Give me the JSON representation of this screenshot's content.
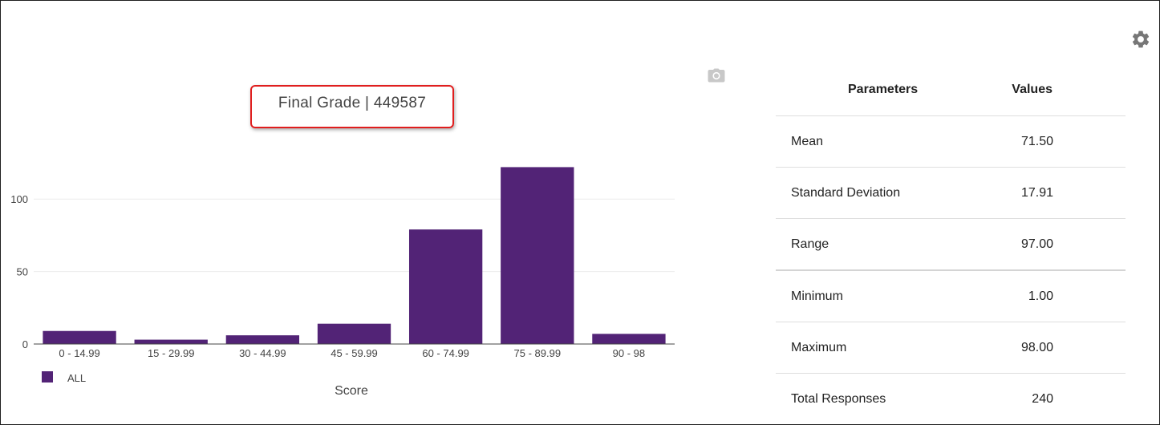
{
  "chart_data": {
    "type": "bar",
    "title": "Final Grade | 449587",
    "categories": [
      "0 - 14.99",
      "15 - 29.99",
      "30 - 44.99",
      "45 - 59.99",
      "60 - 74.99",
      "75 - 89.99",
      "90 - 98"
    ],
    "series": [
      {
        "name": "ALL",
        "values": [
          9,
          3,
          6,
          14,
          79,
          122,
          7
        ]
      }
    ],
    "xlabel": "Score",
    "ylabel": "",
    "ylim": [
      0,
      125
    ],
    "yticks": [
      0,
      50,
      100
    ],
    "grid": true,
    "legend": "bottom-left",
    "bar_color": "#522376"
  },
  "stats": {
    "header": {
      "param": "Parameters",
      "value": "Values"
    },
    "rows": [
      {
        "param": "Mean",
        "value": "71.50"
      },
      {
        "param": "Standard Deviation",
        "value": "17.91"
      },
      {
        "param": "Range",
        "value": "97.00"
      },
      {
        "param": "Minimum",
        "value": "1.00"
      },
      {
        "param": "Maximum",
        "value": "98.00"
      },
      {
        "param": "Total Responses",
        "value": "240"
      }
    ]
  },
  "icons": {
    "settings": "gear-icon",
    "snapshot": "camera-icon"
  },
  "colors": {
    "highlight_box": "#e01e1e",
    "icon": "#777777"
  }
}
